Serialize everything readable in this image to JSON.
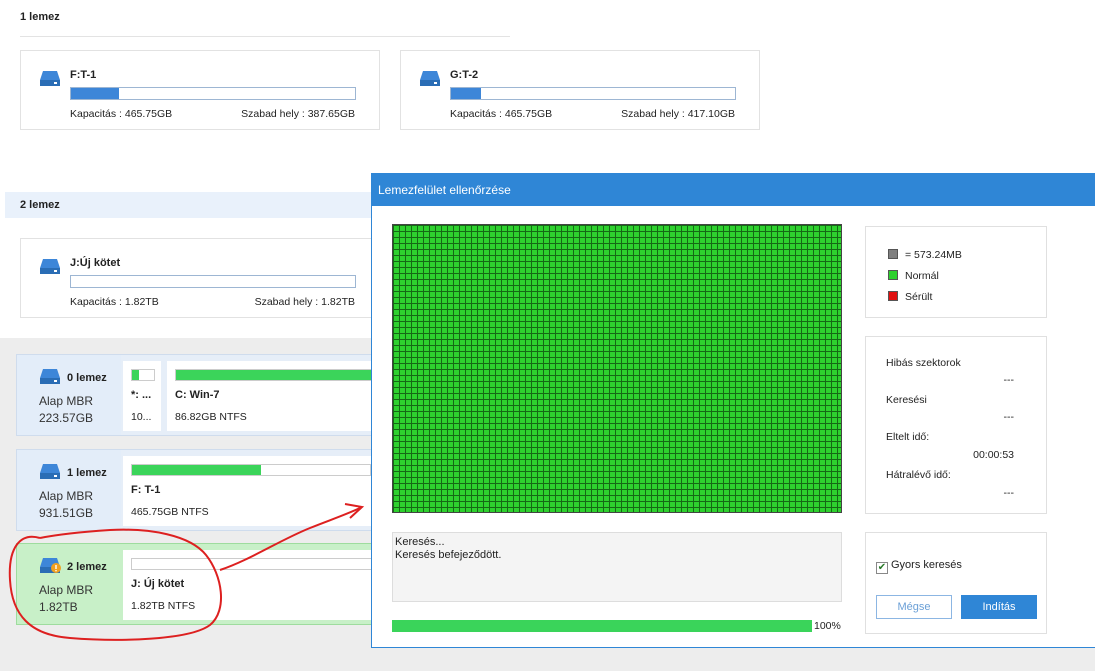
{
  "disks_top": [
    {
      "heading": "1 lemez",
      "volumes": [
        {
          "name": "F:T-1",
          "capacity": "Kapacitás : 465.75GB",
          "free": "Szabad hely : 387.65GB",
          "used_fraction": 0.17
        },
        {
          "name": "G:T-2",
          "capacity": "Kapacitás : 465.75GB",
          "free": "Szabad hely : 417.10GB",
          "used_fraction": 0.105
        }
      ]
    },
    {
      "heading": "2 lemez",
      "volumes": [
        {
          "name": "J:Új kötet",
          "capacity": "Kapacitás : 1.82TB",
          "free": "Szabad hely : 1.82TB",
          "used_fraction": 0.0
        }
      ]
    }
  ],
  "disk_map": [
    {
      "name": "0 lemez",
      "type": "Alap MBR",
      "size": "223.57GB",
      "partitions": [
        {
          "name": "*: ...",
          "info": "10...",
          "used_fraction": 0.3
        },
        {
          "name": "C: Win-7",
          "info": "86.82GB NTFS",
          "used_fraction": 1.0
        }
      ]
    },
    {
      "name": "1 lemez",
      "type": "Alap MBR",
      "size": "931.51GB",
      "partitions": [
        {
          "name": "F: T-1",
          "info": "465.75GB NTFS",
          "used_fraction": 0.54
        }
      ]
    },
    {
      "name": "2 lemez",
      "type": "Alap MBR",
      "size": "1.82TB",
      "partitions": [
        {
          "name": "J: Új kötet",
          "info": "1.82TB NTFS",
          "used_fraction": 0.0
        }
      ]
    }
  ],
  "dialog": {
    "title": "Lemezfelület ellenőrzése",
    "legend": {
      "block_size": "= 573.24MB",
      "normal": "Normál",
      "damaged": "Sérült"
    },
    "colors": {
      "block": "#808080",
      "normal": "#2ed12e",
      "damaged": "#e01010",
      "accent": "#2f86d6"
    },
    "stats": {
      "bad_sectors_label": "Hibás szektorok",
      "bad_sectors_value": "---",
      "search_label": "Keresési",
      "search_value": "---",
      "elapsed_label": "Eltelt idő:",
      "elapsed_value": "00:00:53",
      "remaining_label": "Hátralévő idő:",
      "remaining_value": "---"
    },
    "log": [
      "Keresés...",
      "Keresés befejeződött."
    ],
    "progress_percent": "100%",
    "progress_fraction": 1.0,
    "quick_search_label": "Gyors keresés",
    "quick_search_checked": true,
    "cancel_label": "Mégse",
    "start_label": "Indítás"
  }
}
